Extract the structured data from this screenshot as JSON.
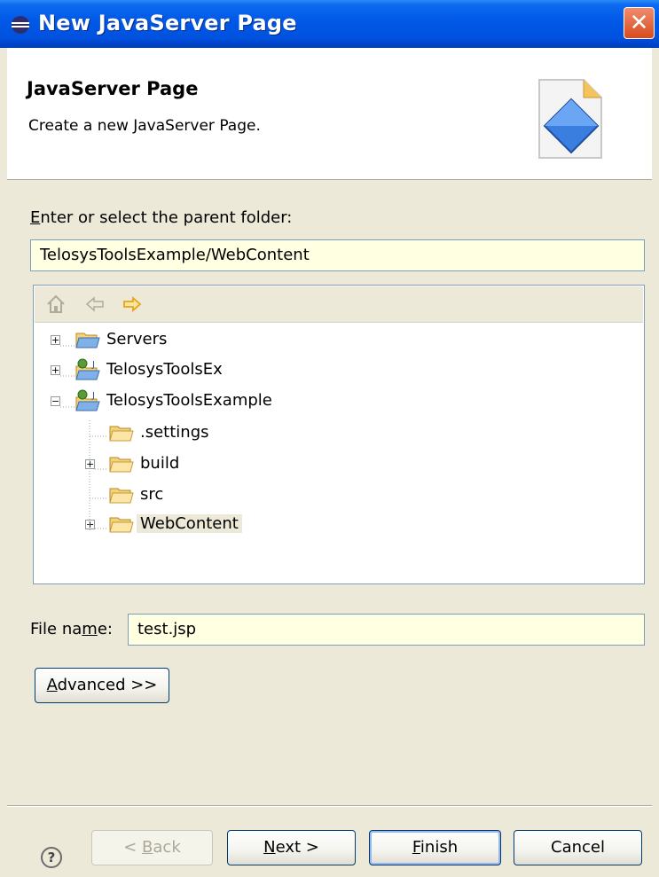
{
  "window": {
    "title": "New JavaServer Page",
    "close_glyph": "✕"
  },
  "header": {
    "title": "JavaServer Page",
    "description": "Create a new JavaServer Page."
  },
  "parent_folder": {
    "label_first": "E",
    "label_rest": "nter or select the parent folder:",
    "value": "TelosysToolsExample/WebContent"
  },
  "tree": {
    "toolbar": [
      "home-icon",
      "back-arrow-icon",
      "forward-arrow-icon"
    ],
    "items": [
      {
        "label": "Servers",
        "expander": "+",
        "icon": "folder-icon"
      },
      {
        "label": "TelosysToolsEx",
        "expander": "+",
        "icon": "java-project-icon"
      },
      {
        "label": "TelosysToolsExample",
        "expander": "−",
        "icon": "java-project-icon"
      },
      {
        "label": ".settings",
        "expander": "",
        "icon": "folder-icon"
      },
      {
        "label": "build",
        "expander": "+",
        "icon": "folder-icon"
      },
      {
        "label": "src",
        "expander": "",
        "icon": "folder-icon"
      },
      {
        "label": "WebContent",
        "expander": "+",
        "icon": "folder-icon",
        "selected": true
      }
    ]
  },
  "file_name": {
    "label_a": "File na",
    "label_u": "m",
    "label_b": "e:",
    "value": "test.jsp"
  },
  "advanced_button": {
    "label_u": "A",
    "label_rest": "dvanced >>"
  },
  "buttons": {
    "back_a": "< ",
    "back_u": "B",
    "back_b": "ack",
    "next_u": "N",
    "next_b": "ext >",
    "finish_u": "F",
    "finish_b": "inish",
    "cancel": "Cancel"
  },
  "help_glyph": "?"
}
